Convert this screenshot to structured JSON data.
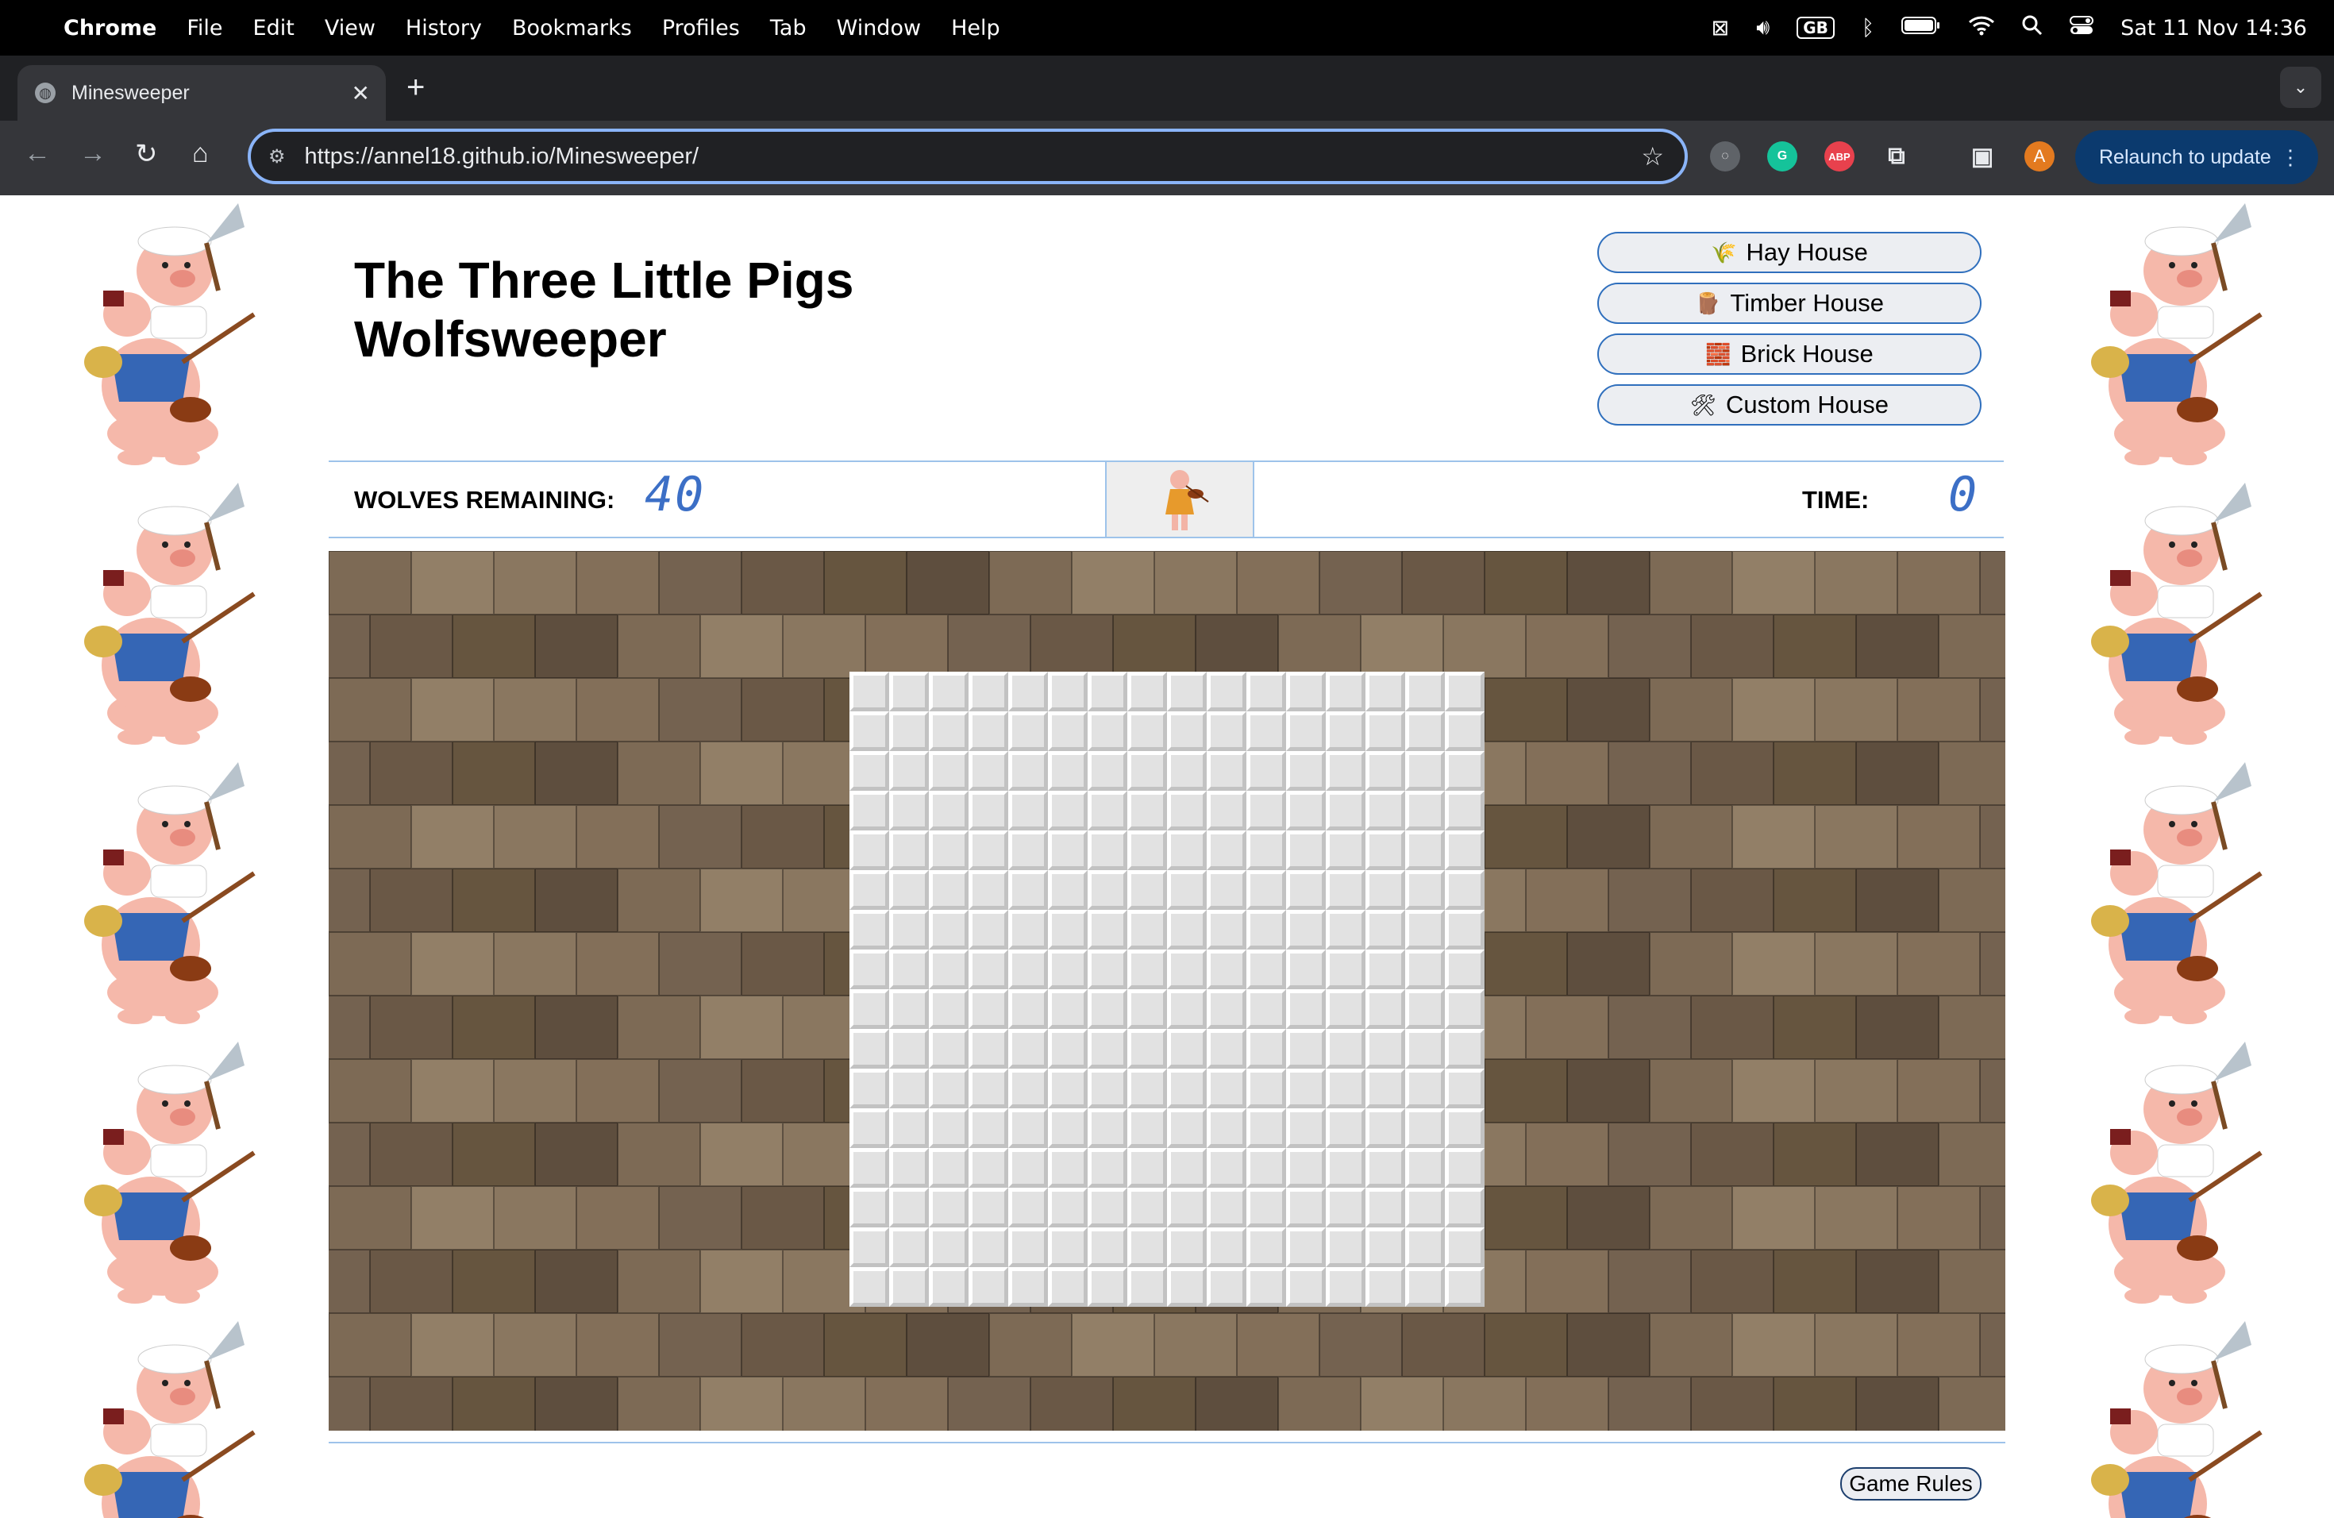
{
  "menubar": {
    "app_name": "Chrome",
    "items": [
      "File",
      "Edit",
      "View",
      "History",
      "Bookmarks",
      "Profiles",
      "Tab",
      "Window",
      "Help"
    ],
    "keyboard_layout": "GB",
    "datetime": "Sat 11 Nov  14:36"
  },
  "browser": {
    "tab_title": "Minesweeper",
    "url_host": "https://annel18.github.io/",
    "url_path": "Minesweeper/",
    "abp_label": "ABP",
    "profile_initial": "A",
    "relaunch_label": "Relaunch to update"
  },
  "game": {
    "title_line1": "The Three Little Pigs",
    "title_line2": "Wolfsweeper",
    "difficulty_buttons": [
      {
        "icon": "hay-icon",
        "glyph": "🌾",
        "label": "Hay House"
      },
      {
        "icon": "wood-icon",
        "glyph": "🪵",
        "label": "Timber House"
      },
      {
        "icon": "brick-icon",
        "glyph": "🧱",
        "label": "Brick House"
      },
      {
        "icon": "tools-icon",
        "glyph": "🛠",
        "label": "Custom House"
      }
    ],
    "wolves_label": "WOLVES REMAINING:",
    "wolves_remaining": "40",
    "time_label": "TIME:",
    "time_value": "0",
    "grid_rows": 16,
    "grid_cols": 16,
    "rules_button": "Game Rules"
  },
  "colors": {
    "accent": "#3c6fc6",
    "divider": "#9ec3ea",
    "board_bg": "#6b5a47"
  }
}
